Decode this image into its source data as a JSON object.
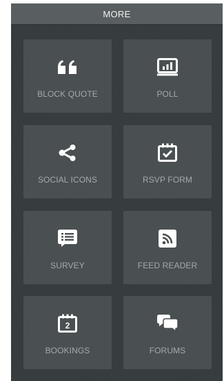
{
  "header": {
    "title": "MORE"
  },
  "tiles": [
    {
      "label": "BLOCK QUOTE",
      "icon": "quote-icon"
    },
    {
      "label": "POLL",
      "icon": "bar-chart-icon"
    },
    {
      "label": "SOCIAL ICONS",
      "icon": "share-icon"
    },
    {
      "label": "RSVP FORM",
      "icon": "calendar-check-icon"
    },
    {
      "label": "SURVEY",
      "icon": "list-bubble-icon"
    },
    {
      "label": "FEED READER",
      "icon": "rss-icon"
    },
    {
      "label": "BOOKINGS",
      "icon": "calendar-icon",
      "badge": "2"
    },
    {
      "label": "FORUMS",
      "icon": "chat-bubbles-icon"
    }
  ],
  "colors": {
    "panel": "#363b3e",
    "header": "#595e61",
    "tile": "#4a4f52",
    "icon": "#ffffff",
    "label": "#a4a9ac"
  }
}
